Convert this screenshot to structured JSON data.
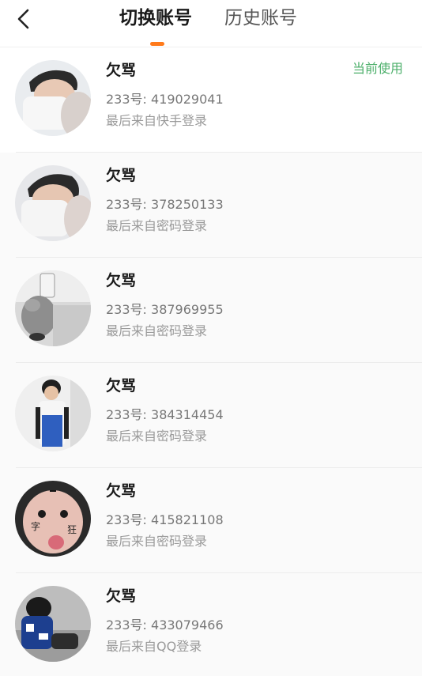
{
  "header": {
    "tabs": [
      {
        "label": "切换账号",
        "active": true
      },
      {
        "label": "历史账号",
        "active": false
      }
    ],
    "indicator_color": "#ff7a1a"
  },
  "accounts": [
    {
      "name": "欠骂",
      "uid": "233号: 419029041",
      "last_login": "最后来自快手登录",
      "current": "当前使用"
    },
    {
      "name": "欠骂",
      "uid": "233号: 378250133",
      "last_login": "最后来自密码登录"
    },
    {
      "name": "欠骂",
      "uid": "233号: 387969955",
      "last_login": "最后来自密码登录"
    },
    {
      "name": "欠骂",
      "uid": "233号: 384314454",
      "last_login": "最后来自密码登录"
    },
    {
      "name": "欠骂",
      "uid": "233号: 415821108",
      "last_login": "最后来自密码登录",
      "avatar_text": [
        "字",
        "狂"
      ]
    },
    {
      "name": "欠骂",
      "uid": "233号: 433079466",
      "last_login": "最后来自QQ登录"
    }
  ],
  "colors": {
    "current_badge": "#4caf6a",
    "primary_text": "#1a1a1a",
    "secondary_text": "#777777"
  }
}
